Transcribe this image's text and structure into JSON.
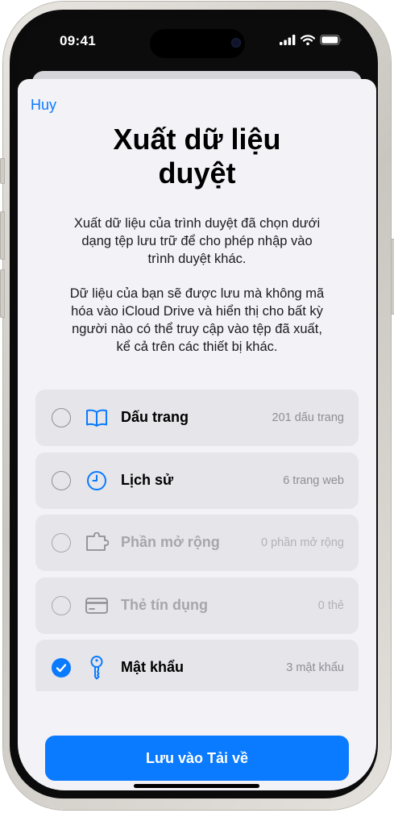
{
  "status_bar": {
    "time": "09:41"
  },
  "sheet": {
    "cancel_label": "Huy",
    "title_line1": "Xuất dữ liệu",
    "title_line2": "duyệt",
    "description1_lines": [
      "Xuất dữ liệu của trình duyệt đã chọn dưới",
      "dạng tệp lưu trữ để cho phép nhập vào",
      "trình duyệt khác."
    ],
    "description2_lines": [
      "Dữ liệu của bạn sẽ được lưu mà không mã",
      "hóa vào iCloud Drive và hiển thị cho bất kỳ",
      "người nào có thể truy cập vào tệp đã xuất,",
      "kể cả trên các thiết bị khác."
    ],
    "items": [
      {
        "label": "Dấu trang",
        "count": "201 dấu trang",
        "icon": "book-icon",
        "checked": false,
        "enabled": true
      },
      {
        "label": "Lịch sử",
        "count": "6 trang web",
        "icon": "clock-icon",
        "checked": false,
        "enabled": true
      },
      {
        "label": "Phần mở rộng",
        "count": "0 phần mở rộng",
        "icon": "extension-icon",
        "checked": false,
        "enabled": false
      },
      {
        "label": "Thẻ tín dụng",
        "count": "0 thẻ",
        "icon": "credit-card-icon",
        "checked": false,
        "enabled": false
      },
      {
        "label": "Mật khẩu",
        "count": "3 mật khẩu",
        "icon": "key-icon",
        "checked": true,
        "enabled": true
      }
    ],
    "save_button_label": "Lưu vào Tải về"
  },
  "colors": {
    "accent": "#0a7aff",
    "sheet_bg": "#f2f2f7",
    "row_bg": "#e5e5ea",
    "disabled_text": "#a7a7ab"
  }
}
